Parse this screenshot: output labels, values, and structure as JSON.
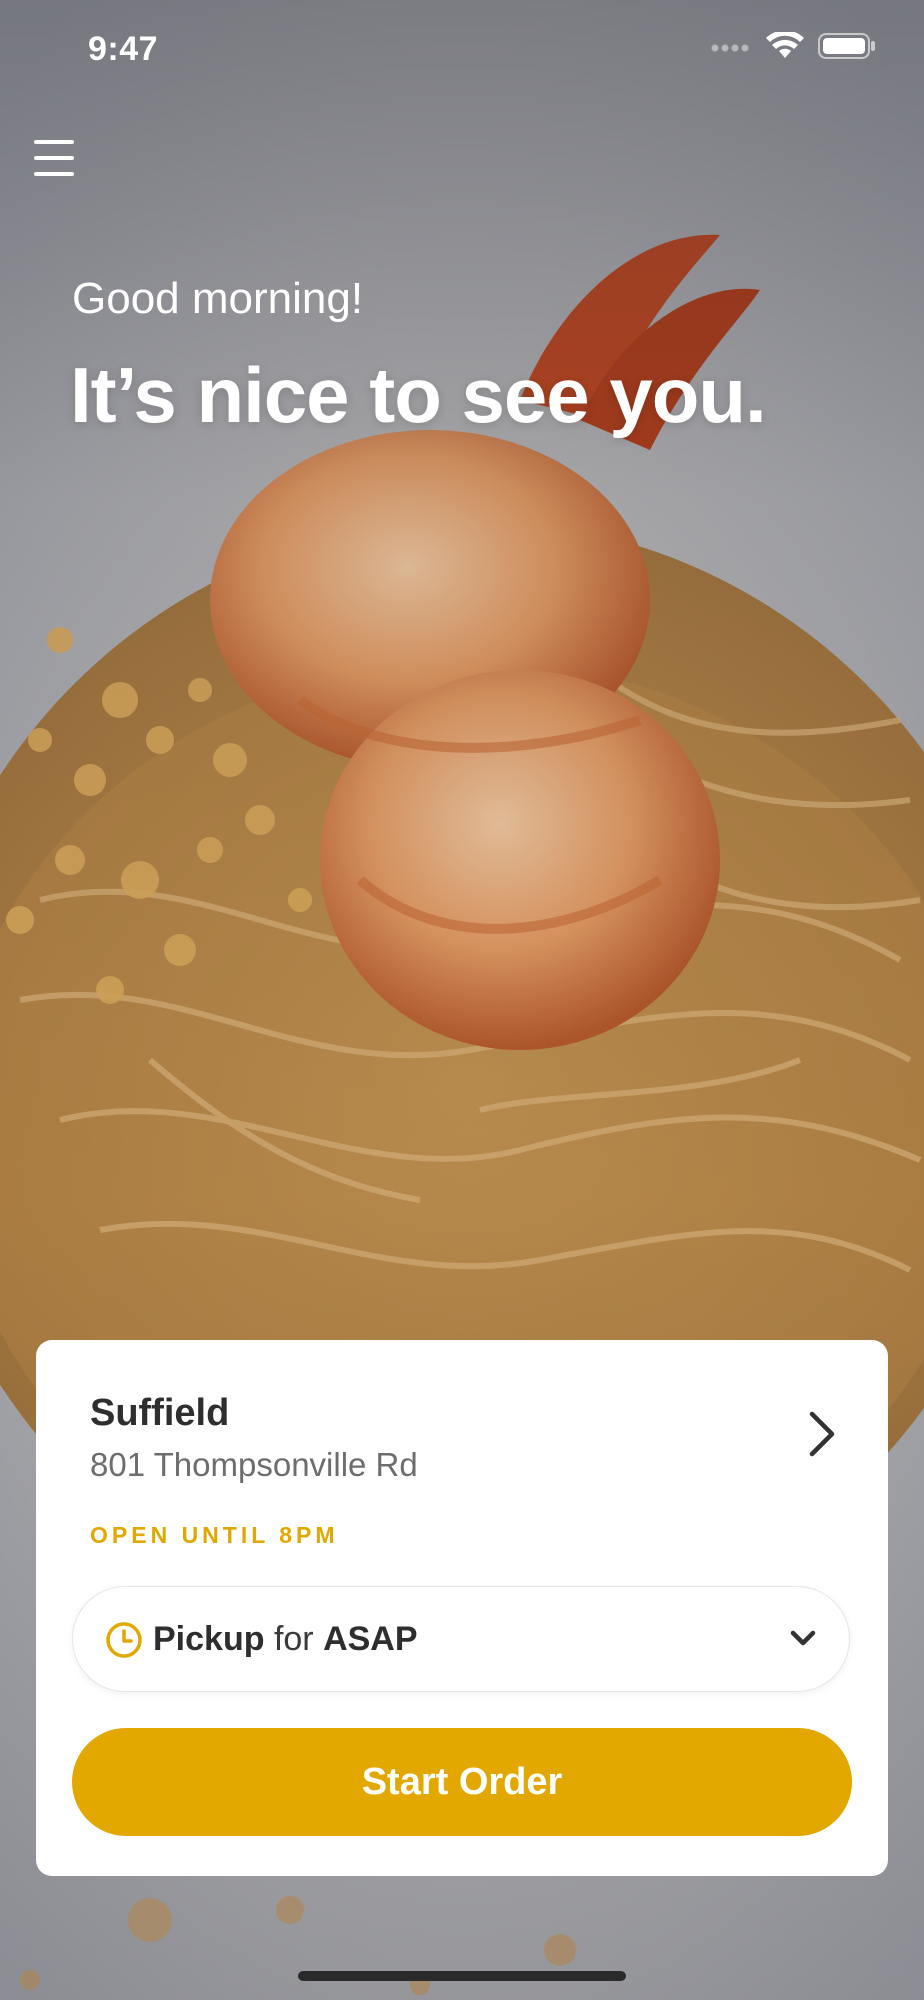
{
  "status_bar": {
    "time": "9:47",
    "icons": [
      "signal-icon",
      "wifi-icon",
      "battery-icon"
    ]
  },
  "header": {
    "menu_icon": "hamburger-menu-icon"
  },
  "greeting": {
    "subtitle": "Good morning!",
    "title": "It’s nice to see you."
  },
  "location_card": {
    "store_name": "Suffield",
    "address": "801 Thompsonville Rd",
    "hours": "OPEN UNTIL 8PM",
    "chevron_icon": "chevron-right-icon"
  },
  "order_type": {
    "clock_icon": "clock-icon",
    "mode": "Pickup",
    "connector": "for",
    "time": "ASAP",
    "caret_icon": "chevron-down-icon"
  },
  "actions": {
    "start_order_label": "Start Order"
  },
  "colors": {
    "accent": "#e2a800",
    "text_dark": "#2e2e2e",
    "text_muted": "#6d6d6d",
    "card_background": "#ffffff"
  },
  "background_image": "shrimp-pad-thai-photo"
}
